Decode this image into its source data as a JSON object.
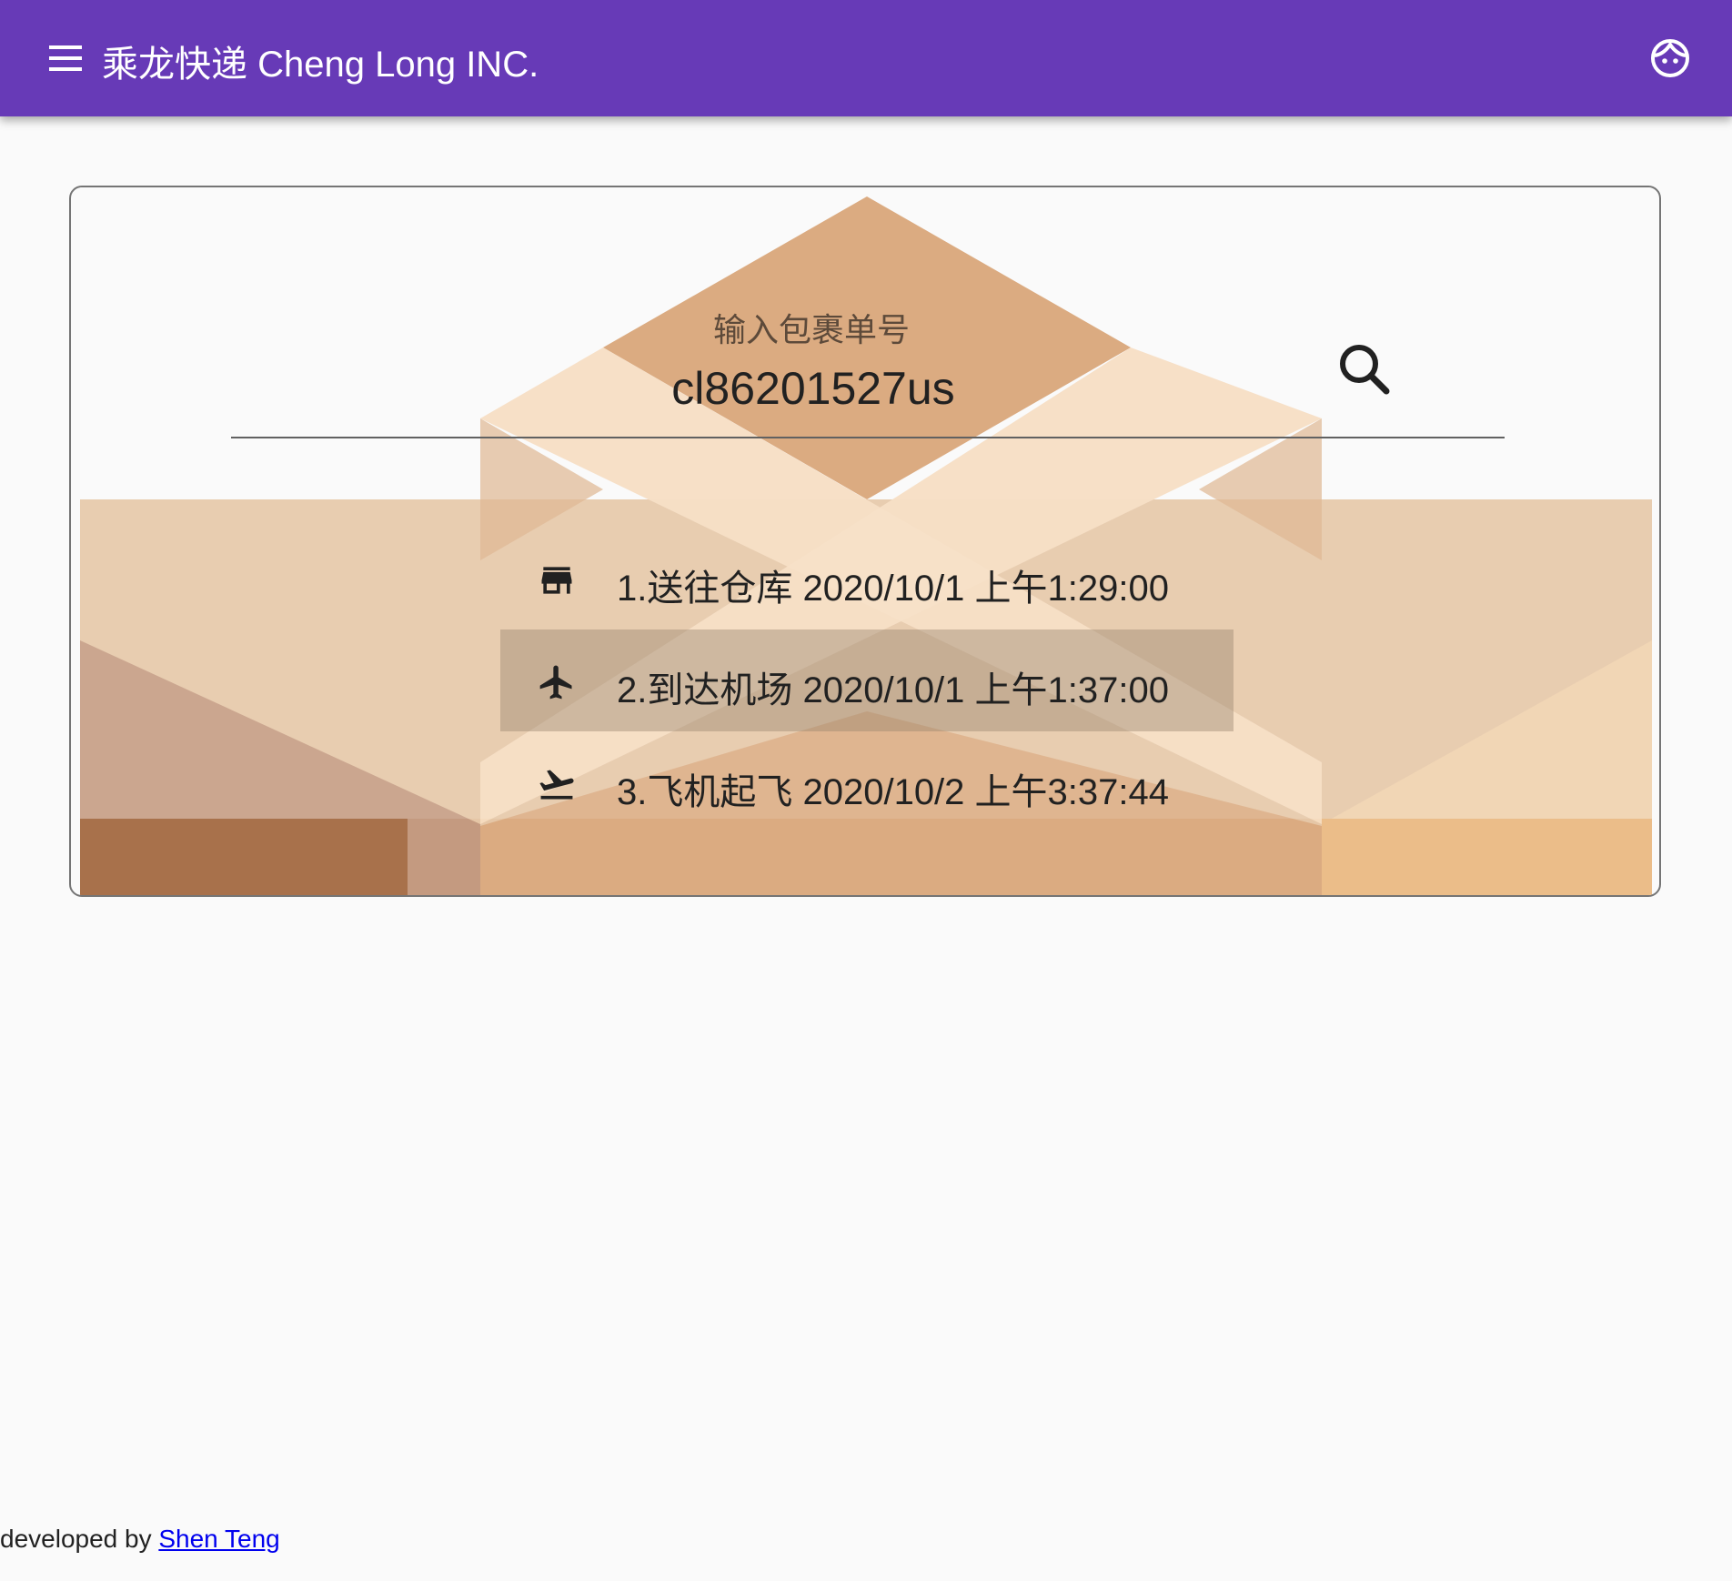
{
  "colors": {
    "appbar": "#673ab7",
    "link": "#0000ee"
  },
  "appbar": {
    "title": "乘龙快递 Cheng Long INC.",
    "menu_icon": "menu-icon",
    "account_icon": "face-icon"
  },
  "search": {
    "label": "输入包裹单号",
    "value": "cl86201527us",
    "icon": "search-icon"
  },
  "tracking": [
    {
      "text": "1.送往仓库 2020/10/1 上午1:29:00",
      "icon": "store-icon",
      "active": false
    },
    {
      "text": "2.到达机场 2020/10/1 上午1:37:00",
      "icon": "airplane-icon",
      "active": true
    },
    {
      "text": "3.飞机起飞 2020/10/2 上午3:37:44",
      "icon": "flight-takeoff-icon",
      "active": false
    }
  ],
  "footer": {
    "prefix": "developed by ",
    "link_text": "Shen Teng"
  }
}
